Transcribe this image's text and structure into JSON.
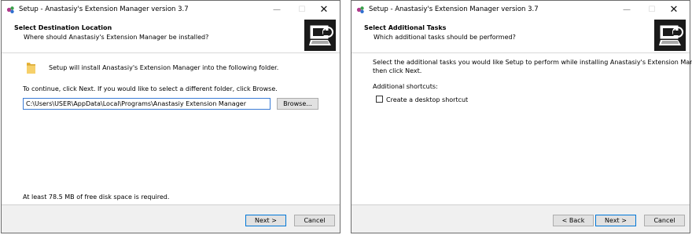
{
  "colors": {
    "window_border": "#6b6b6b",
    "client_bg": "#ffffff",
    "footer_bg": "#f0f0f0",
    "focus_border": "#0078d7",
    "logo_bg": "#1a1a1a"
  },
  "window1": {
    "title": "Setup - Anastasiy's Extension Manager version 3.7",
    "controls": {
      "minimize": "—",
      "maximize": "☐",
      "close": "✕"
    },
    "header": {
      "title": "Select Destination Location",
      "subtitle": "Where should Anastasiy's Extension Manager be installed?"
    },
    "icons": {
      "app": "setup-app-icon",
      "logo": "installer-computer-logo",
      "folder": "folder-icon"
    },
    "folder_text": "Setup will install Anastasiy's Extension Manager into the following folder.",
    "instruction": "To continue, click Next. If you would like to select a different folder, click Browse.",
    "path_value": "C:\\Users\\USER\\AppData\\Local\\Programs\\Anastasiy Extension Manager",
    "browse_label": "Browse...",
    "disk_space": "At least 78.5 MB of free disk space is required.",
    "next_label": "Next >",
    "cancel_label": "Cancel"
  },
  "window2": {
    "title": "Setup - Anastasiy's Extension Manager version 3.7",
    "controls": {
      "minimize": "—",
      "maximize": "☐",
      "close": "✕"
    },
    "header": {
      "title": "Select Additional Tasks",
      "subtitle": "Which additional tasks should be performed?"
    },
    "icons": {
      "app": "setup-app-icon",
      "logo": "installer-computer-logo"
    },
    "description_line1": "Select the additional tasks you would like Setup to perform while installing Anastasiy's Extension Manager,",
    "description_line2": "then click Next.",
    "shortcuts_label": "Additional shortcuts:",
    "checkbox_label": "Create a desktop shortcut",
    "checkbox_checked": false,
    "back_label": "< Back",
    "next_label": "Next >",
    "cancel_label": "Cancel"
  }
}
